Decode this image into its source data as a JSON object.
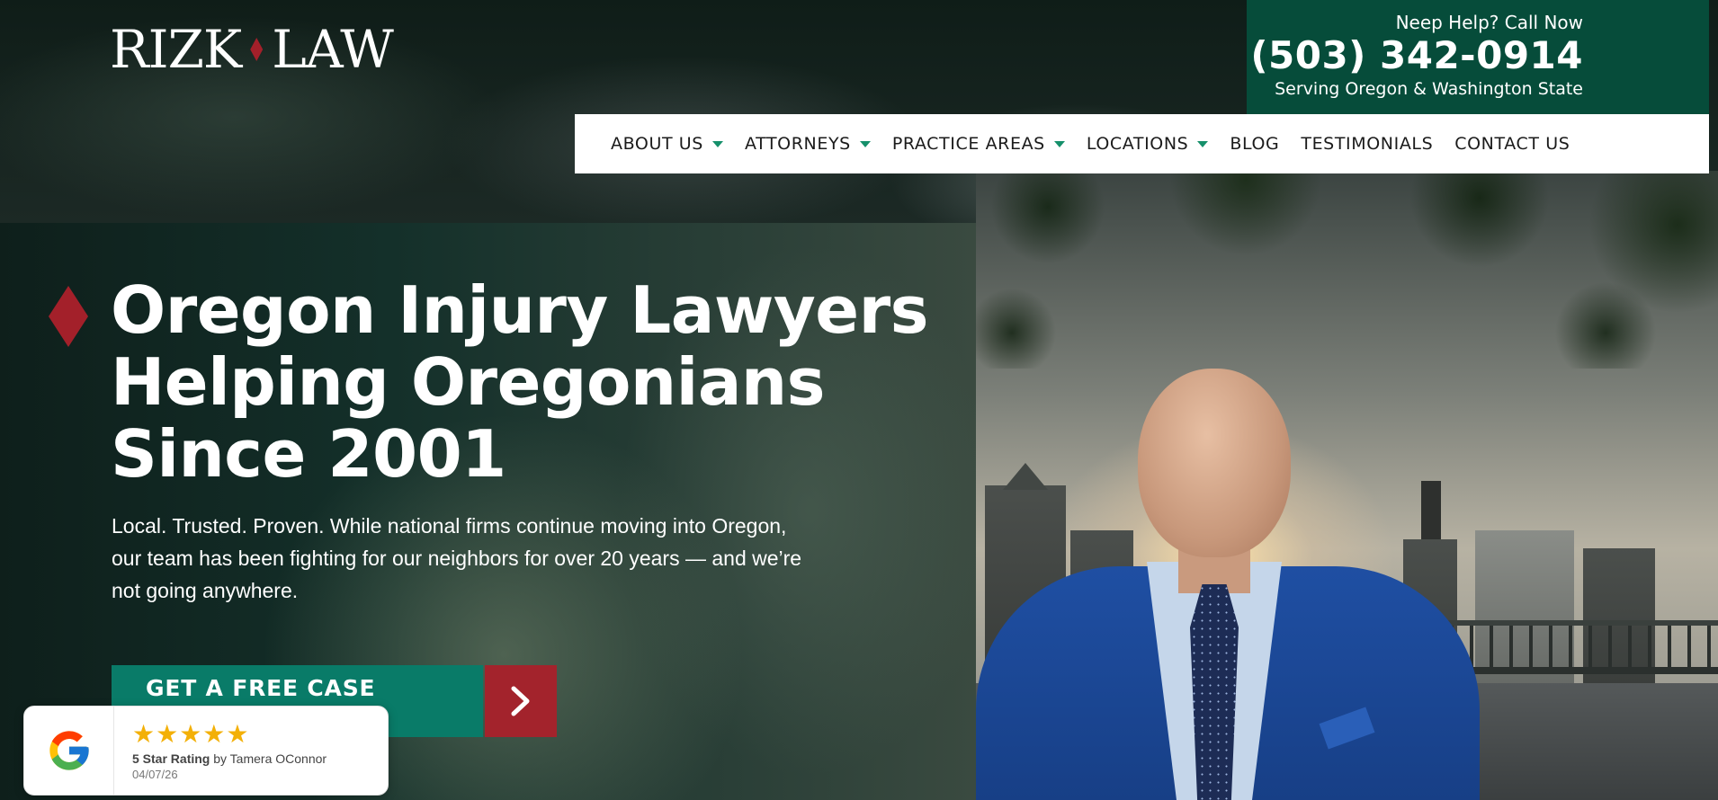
{
  "brand": {
    "logo_left": "RIZK",
    "logo_right": "LAW"
  },
  "contact": {
    "help_text": "Neep Help? Call Now",
    "phone": "(503) 342-0914",
    "serving": "Serving Oregon & Washington State"
  },
  "nav": {
    "items": [
      {
        "label": "ABOUT US",
        "dropdown": true
      },
      {
        "label": "ATTORNEYS",
        "dropdown": true
      },
      {
        "label": "PRACTICE AREAS",
        "dropdown": true
      },
      {
        "label": "LOCATIONS",
        "dropdown": true
      },
      {
        "label": "BLOG",
        "dropdown": false
      },
      {
        "label": "TESTIMONIALS",
        "dropdown": false
      },
      {
        "label": "CONTACT US",
        "dropdown": false
      }
    ]
  },
  "hero": {
    "title_line1": "Oregon Injury Lawyers",
    "title_line2": "Helping Oregonians",
    "title_line3": "Since 2001",
    "subtitle_line1": "Local. Trusted. Proven. While national firms continue moving into Oregon,",
    "subtitle_line2": "our team has been fighting for our neighbors for over 20 years — and we’re",
    "subtitle_line3": "not going anywhere.",
    "cta_label": "GET A FREE CASE REVIEW"
  },
  "review": {
    "stars": "★★★★★",
    "rating_label": "5 Star Rating",
    "by_text": " by Tamera OConnor",
    "date": "04/07/26"
  },
  "colors": {
    "brand_green": "#064c3a",
    "cta_green": "#097b68",
    "brand_red": "#a3202a",
    "caret_green": "#16906b"
  }
}
